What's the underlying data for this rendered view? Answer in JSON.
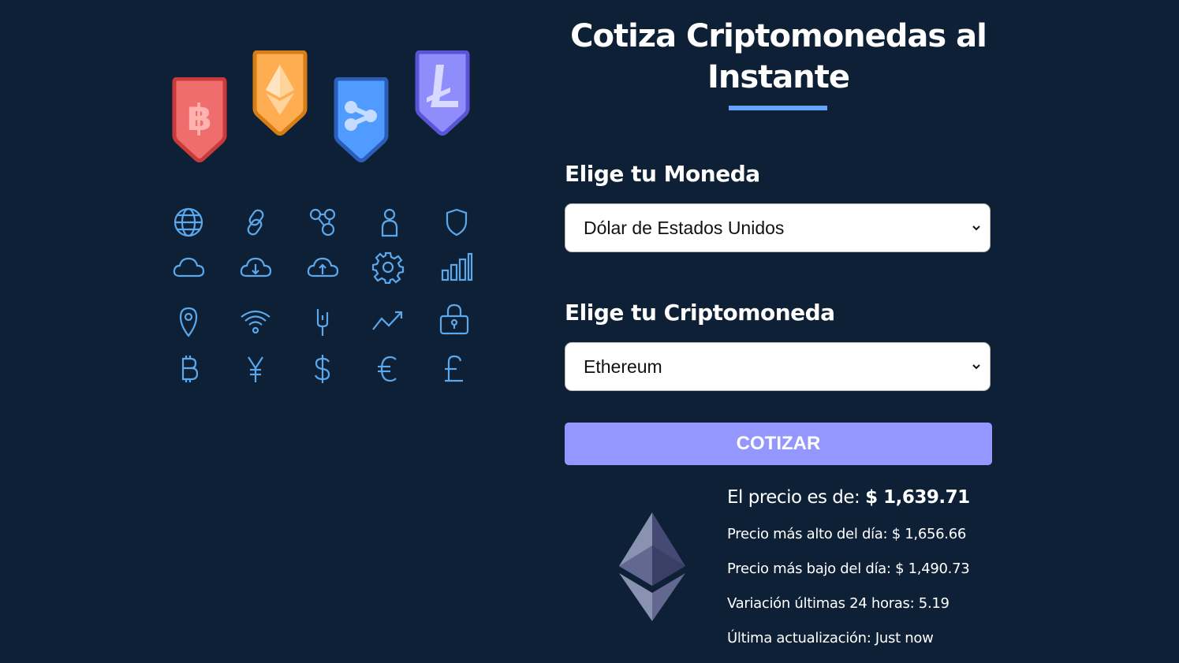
{
  "title": "Cotiza Criptomonedas al Instante",
  "form": {
    "currency_label": "Elige tu Moneda",
    "currency_selected": "Dólar de Estados Unidos",
    "crypto_label": "Elige tu Criptomoneda",
    "crypto_selected": "Ethereum",
    "submit_label": "COTIZAR"
  },
  "result": {
    "price_prefix": "El precio es de:",
    "price_value": "$ 1,639.71",
    "high": "Precio más alto del día: $ 1,656.66",
    "low": "Precio más bajo del día: $ 1,490.73",
    "change": "Variación últimas 24 horas: 5.19",
    "updated": "Última actualización: Just now"
  },
  "illustration": {
    "badges": [
      {
        "icon": "bitcoin-icon",
        "color": "#f06d6d",
        "border": "#c93a3a"
      },
      {
        "icon": "ethereum-icon",
        "color": "#ffad51",
        "border": "#d67d16"
      },
      {
        "icon": "ripple-icon",
        "color": "#4f9bff",
        "border": "#2a5eb8"
      },
      {
        "icon": "litecoin-icon",
        "color": "#8f8dfc",
        "border": "#5a54d6"
      }
    ],
    "grid_icons": [
      "globe-icon",
      "link-icon",
      "molecule-icon",
      "user-icon",
      "shield-icon",
      "cloud-icon",
      "cloud-download-icon",
      "cloud-upload-icon",
      "gear-icon",
      "bar-chart-icon",
      "location-pin-icon",
      "wifi-icon",
      "fork-icon",
      "trend-up-icon",
      "lock-icon",
      "bitcoin-symbol-icon",
      "yen-icon",
      "dollar-icon",
      "euro-icon",
      "pound-icon"
    ],
    "icon_color": "#5ba8ec"
  },
  "colors": {
    "background": "#0e2036",
    "accent": "#66a2fe",
    "button": "#9497ff"
  }
}
